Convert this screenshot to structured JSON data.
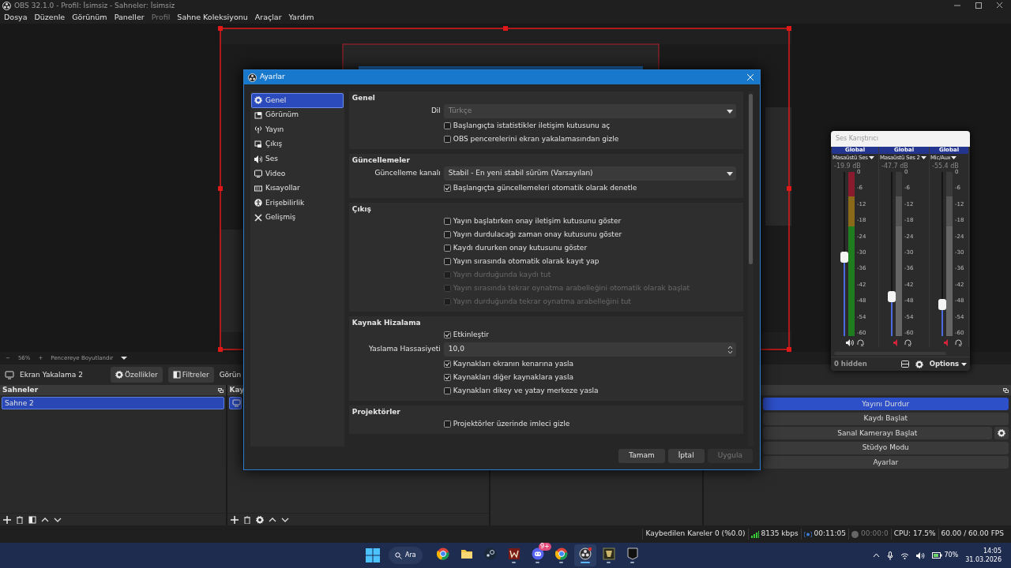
{
  "window": {
    "title": "OBS 32.1.0 - Profil: İsimsiz - Sahneler: İsimsiz"
  },
  "menu": [
    {
      "label": "Dosya",
      "disabled": false
    },
    {
      "label": "Düzenle",
      "disabled": false
    },
    {
      "label": "Görünüm",
      "disabled": false
    },
    {
      "label": "Paneller",
      "disabled": false
    },
    {
      "label": "Profil",
      "disabled": true
    },
    {
      "label": "Sahne Koleksiyonu",
      "disabled": false
    },
    {
      "label": "Araçlar",
      "disabled": false
    },
    {
      "label": "Yardım",
      "disabled": false
    }
  ],
  "zoom_bar": {
    "minus": "−",
    "zoom": "56%",
    "plus": "+",
    "fit": "Pencereye Boyutlandır"
  },
  "source_toolbar": {
    "source": "Ekran Yakalama 2",
    "buttons": [
      {
        "kind": "properties",
        "label": "Özellikler"
      },
      {
        "kind": "filters",
        "label": "Filtreler"
      }
    ],
    "cut_label": "Görün"
  },
  "scenes": {
    "title": "Sahneler",
    "items": [
      {
        "label": "Sahne 2",
        "selected": true
      }
    ]
  },
  "sources": {
    "title": "Kay",
    "items": [
      {
        "kind": "display",
        "selected": true
      }
    ]
  },
  "controls": {
    "buttons": [
      {
        "label": "Yayını Durdur",
        "selected": true,
        "has_settings": false
      },
      {
        "label": "Kaydı Başlat",
        "selected": false,
        "has_settings": false
      },
      {
        "label": "Sanal Kamerayı Başlat",
        "selected": false,
        "has_settings": true
      },
      {
        "label": "Stüdyo Modu",
        "selected": false,
        "has_settings": false
      },
      {
        "label": "Ayarlar",
        "selected": false,
        "has_settings": false
      }
    ]
  },
  "status_bar": {
    "dropped": "Kaybedilen Kareler 0 (%0.0)",
    "bitrate": "8135 kbps",
    "stream_time": "00:11:05",
    "record_time": "00:00:0",
    "cpu": "CPU: 17.5%",
    "fps": "60.00 / 60.00 FPS"
  },
  "settings": {
    "title": "Ayarlar",
    "sidebar": [
      {
        "kind": "gear",
        "label": "Genel",
        "selected": true
      },
      {
        "kind": "appearance",
        "label": "Görünüm",
        "selected": false
      },
      {
        "kind": "antenna",
        "label": "Yayın",
        "selected": false
      },
      {
        "kind": "output",
        "label": "Çıkış",
        "selected": false
      },
      {
        "kind": "speaker",
        "label": "Ses",
        "selected": false
      },
      {
        "kind": "monitor",
        "label": "Video",
        "selected": false
      },
      {
        "kind": "keyboard",
        "label": "Kısayollar",
        "selected": false
      },
      {
        "kind": "accessibility",
        "label": "Erişebilirlik",
        "selected": false
      },
      {
        "kind": "tools",
        "label": "Gelişmiş",
        "selected": false
      }
    ],
    "sections": [
      {
        "title": "Genel",
        "rows": [
          {
            "kind": "select",
            "label": "Dil",
            "value": "Türkçe",
            "disabled": true
          },
          {
            "kind": "checkbox",
            "label": "Başlangıçta istatistikler iletişim kutusunu aç",
            "checked": false,
            "disabled": false
          },
          {
            "kind": "checkbox",
            "label": "OBS pencerelerini ekran yakalamasından gizle",
            "checked": false,
            "disabled": false
          }
        ]
      },
      {
        "title": "Güncellemeler",
        "rows": [
          {
            "kind": "select",
            "label": "Güncelleme kanalı",
            "value": "Stabil - En yeni stabil sürüm (Varsayılan)",
            "disabled": false
          },
          {
            "kind": "checkbox",
            "label": "Başlangıçta güncellemeleri otomatik olarak denetle",
            "checked": true,
            "disabled": false
          }
        ]
      },
      {
        "title": "Çıkış",
        "rows": [
          {
            "kind": "checkbox",
            "label": "Yayın başlatırken onay iletişim kutusunu göster",
            "checked": false,
            "disabled": false
          },
          {
            "kind": "checkbox",
            "label": "Yayın durdulacağı zaman onay kutusunu göster",
            "checked": false,
            "disabled": false
          },
          {
            "kind": "checkbox",
            "label": "Kaydı dururken onay kutusunu göster",
            "checked": false,
            "disabled": false
          },
          {
            "kind": "checkbox",
            "label": "Yayın sırasında otomatik olarak kayıt yap",
            "checked": false,
            "disabled": false
          },
          {
            "kind": "checkbox",
            "label": "Yayın durduğunda kaydı tut",
            "checked": false,
            "disabled": true
          },
          {
            "kind": "checkbox",
            "label": "Yayın sırasında tekrar oynatma arabelleğini otomatik olarak başlat",
            "checked": false,
            "disabled": true
          },
          {
            "kind": "checkbox",
            "label": "Yayın durduğunda tekrar oynatma arabelleğini tut",
            "checked": false,
            "disabled": true
          }
        ]
      },
      {
        "title": "Kaynak Hizalama",
        "rows": [
          {
            "kind": "checkbox",
            "label": "Etkinleştir",
            "checked": true,
            "disabled": false
          },
          {
            "kind": "spin",
            "label": "Yaslama Hassasiyeti",
            "value": "10,0",
            "disabled": false
          },
          {
            "kind": "checkbox",
            "label": "Kaynakları ekranın kenarına yasla",
            "checked": true,
            "disabled": false
          },
          {
            "kind": "checkbox",
            "label": "Kaynakları diğer kaynaklara yasla",
            "checked": true,
            "disabled": false
          },
          {
            "kind": "checkbox",
            "label": "Kaynakları dikey ve yatay merkeze yasla",
            "checked": false,
            "disabled": false
          }
        ]
      },
      {
        "title": "Projektörler",
        "rows": [
          {
            "kind": "checkbox",
            "label": "Projektörler üzerinde imleci gizle",
            "checked": false,
            "disabled": false
          }
        ]
      }
    ],
    "buttons": [
      {
        "label": "Tamam",
        "disabled": false
      },
      {
        "label": "İptal",
        "disabled": false
      },
      {
        "label": "Uygula",
        "disabled": true
      }
    ]
  },
  "mixer": {
    "title": "Ses Karıştırıcı",
    "channels": [
      {
        "group": "Global",
        "name": "Masaüstü Ses",
        "reading": "-19.9 dB",
        "level": 0.48,
        "muted": false,
        "scale": [
          "0",
          "-6",
          "-12",
          "-18",
          "-24",
          "-30",
          "-36",
          "-42",
          "-48",
          "-54",
          "-60"
        ]
      },
      {
        "group": "Global",
        "name": "Masaüstü Ses 2",
        "reading": "-47.7 dB",
        "level": 0.24,
        "muted": true,
        "scale": [
          "0",
          "-6",
          "-12",
          "-18",
          "-24",
          "-30",
          "-36",
          "-42",
          "-48",
          "-54",
          "-60"
        ]
      },
      {
        "group": "Global",
        "name": "Mic/Aux",
        "reading": "-55.4 dB",
        "level": 0.19,
        "muted": true,
        "scale": [
          "0",
          "-6",
          "-12",
          "-18",
          "-24",
          "-30",
          "-36",
          "-42",
          "-48",
          "-54",
          "-60"
        ]
      }
    ],
    "hidden": "0 hidden",
    "options": "Options"
  },
  "taskbar": {
    "search": "Ara",
    "apps": [
      {
        "kind": "browser",
        "running": false,
        "active": false
      },
      {
        "kind": "folder",
        "running": false,
        "active": false
      },
      {
        "kind": "launcher",
        "running": false,
        "active": false
      },
      {
        "kind": "redtile",
        "running": true,
        "active": false
      },
      {
        "kind": "chat",
        "running": true,
        "active": false,
        "badge": "9+"
      },
      {
        "kind": "browser",
        "running": true,
        "active": false
      },
      {
        "kind": "recorder",
        "running": true,
        "active": true
      },
      {
        "kind": "goldtile",
        "running": true,
        "active": false
      },
      {
        "kind": "shield",
        "running": true,
        "active": false
      }
    ],
    "battery": "70%",
    "time": "14:05",
    "date": "31.03.2026"
  }
}
